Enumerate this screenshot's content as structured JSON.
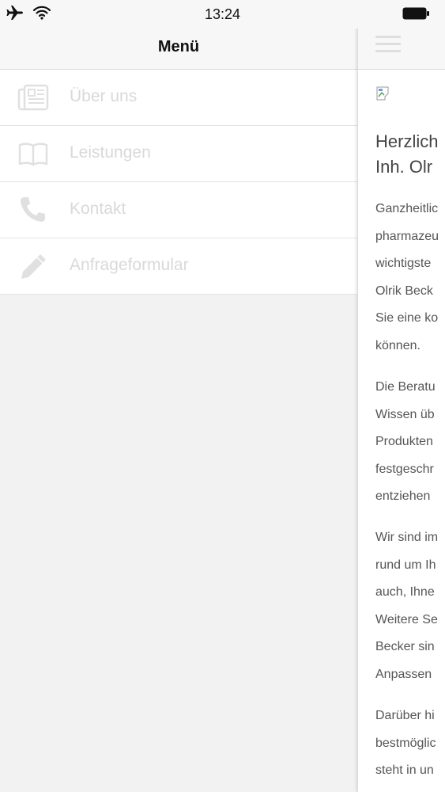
{
  "status_bar": {
    "time": "13:24",
    "left_icons": [
      "airplane-icon",
      "wifi-icon"
    ],
    "right_icons": [
      "battery-icon"
    ]
  },
  "menu": {
    "title": "Menü",
    "items": [
      {
        "label": "Über uns",
        "icon": "newspaper-icon"
      },
      {
        "label": "Leistungen",
        "icon": "book-icon"
      },
      {
        "label": "Kontakt",
        "icon": "phone-icon"
      },
      {
        "label": "Anfrageformular",
        "icon": "pencil-icon"
      }
    ]
  },
  "content": {
    "topbar_icon": "hamburger-icon",
    "image_icon": "broken-image-icon",
    "title_lines": [
      "Herzlich",
      "Inh. Olr"
    ],
    "paragraphs": [
      [
        "Ganzheitlic",
        "pharmazeu",
        "wichtigste",
        "Olrik Beck",
        "Sie eine ko",
        "können."
      ],
      [
        "Die Beratu",
        "Wissen üb",
        "Produkten",
        "festgeschr",
        "entziehen"
      ],
      [
        "Wir sind im",
        "rund um Ih",
        "auch, Ihne",
        "Weitere Se",
        "Becker sin",
        "Anpassen"
      ],
      [
        "Darüber hi",
        "bestmöglic",
        "steht in un"
      ]
    ]
  },
  "colors": {
    "menu_label": "#d9d9d9",
    "icon": "#e0e0e0",
    "text": "#555555",
    "background": "#f2f2f2"
  }
}
